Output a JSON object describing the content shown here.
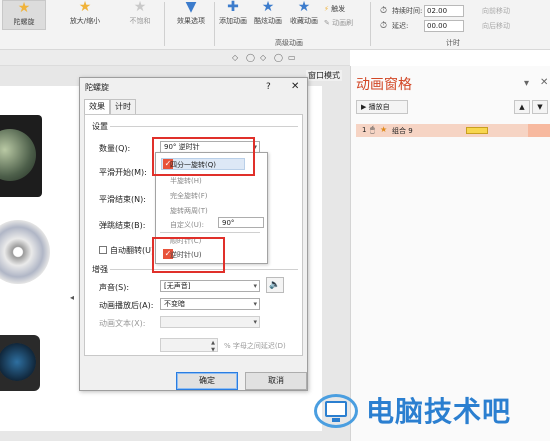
{
  "ribbon": {
    "items": [
      {
        "label": "陀螺旋",
        "icon": "star-icon"
      },
      {
        "label": "放大/缩小",
        "icon": "star-icon"
      },
      {
        "label": "不饱和",
        "icon": "star-icon"
      },
      {
        "label": "效果选项",
        "icon": "options-icon"
      },
      {
        "label": "添加动画",
        "icon": "add-animation-icon"
      },
      {
        "label": "酷炫动画",
        "icon": "star-icon"
      },
      {
        "label": "收藏动画",
        "icon": "star-icon"
      },
      {
        "label": "触发",
        "icon": "trigger-icon"
      },
      {
        "label": "动画刷",
        "icon": "brush-icon"
      }
    ],
    "advanced_group": "高级动画",
    "timing_group": "计时",
    "duration_label": "持续时间:",
    "duration_value": "02.00",
    "delay_label": "延迟:",
    "delay_value": "00.00",
    "move_earlier": "向前移动",
    "move_later": "向后移动"
  },
  "slide_tab": "窗口模式",
  "pane": {
    "title": "动画窗格",
    "play_button": "播放自",
    "item_number": "1",
    "item_name": "组合 9"
  },
  "dialog": {
    "title": "陀螺旋",
    "help": "?",
    "close": "✕",
    "tabs": [
      "效果",
      "计时"
    ],
    "settings_section": "设置",
    "amount_label": "数量(Q):",
    "amount_value": "90° 逆时针",
    "smooth_start_label": "平滑开始(M):",
    "smooth_end_label": "平滑结束(N):",
    "bounce_end_label": "弹跳结束(B):",
    "auto_reverse_label": "自动翻转(U)",
    "enhance_section": "增强",
    "sound_label": "声音(S):",
    "sound_value": "[无声音]",
    "after_anim_label": "动画播放后(A):",
    "after_anim_value": "不变暗",
    "anim_text_label": "动画文本(X):",
    "letter_delay": "% 字母之间延迟(D)",
    "ok": "确定",
    "cancel": "取消"
  },
  "dropdown": {
    "items": [
      "四分一旋转(Q)",
      "半旋转(H)",
      "完全旋转(F)",
      "旋转两周(T)",
      "自定义(U):"
    ],
    "custom_value": "90°",
    "clockwise": "顺时针(C)",
    "counterclockwise": "逆时针(U)"
  },
  "watermark": "电脑技术吧",
  "colors": {
    "accent": "#d24726",
    "highlight_box": "#e0302a",
    "check_fill": "#e8533b"
  }
}
